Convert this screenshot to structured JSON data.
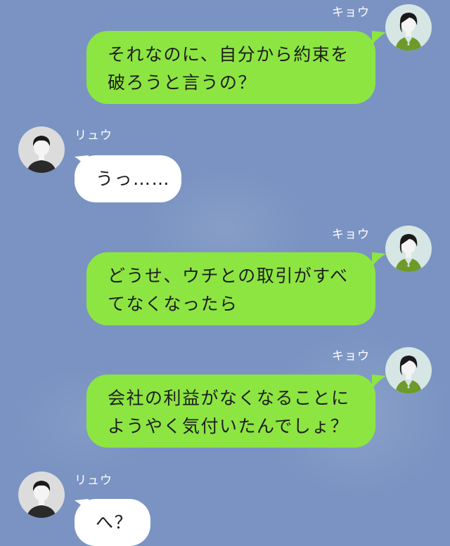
{
  "chat": {
    "messages": [
      {
        "sender": "キョウ",
        "side": "right",
        "lines": [
          "それなのに、自分から約束を",
          "破ろうと言うの？"
        ]
      },
      {
        "sender": "リュウ",
        "side": "left",
        "lines": [
          "うっ……"
        ]
      },
      {
        "sender": "キョウ",
        "side": "right",
        "lines": [
          "どうせ、ウチとの取引がすべ",
          "てなくなったら"
        ]
      },
      {
        "sender": "キョウ",
        "side": "right",
        "lines": [
          "会社の利益がなくなることに",
          "ようやく気付いたんでしょ？"
        ]
      },
      {
        "sender": "リュウ",
        "side": "left",
        "lines": [
          "へ？"
        ]
      }
    ]
  },
  "colors": {
    "background": "#7a93c2",
    "my_bubble": "#8de542",
    "other_bubble": "#ffffff",
    "name_text": "#ffffff"
  },
  "icons": {
    "kyou": "avatar-kyou-icon",
    "ryuu": "avatar-ryuu-icon"
  }
}
